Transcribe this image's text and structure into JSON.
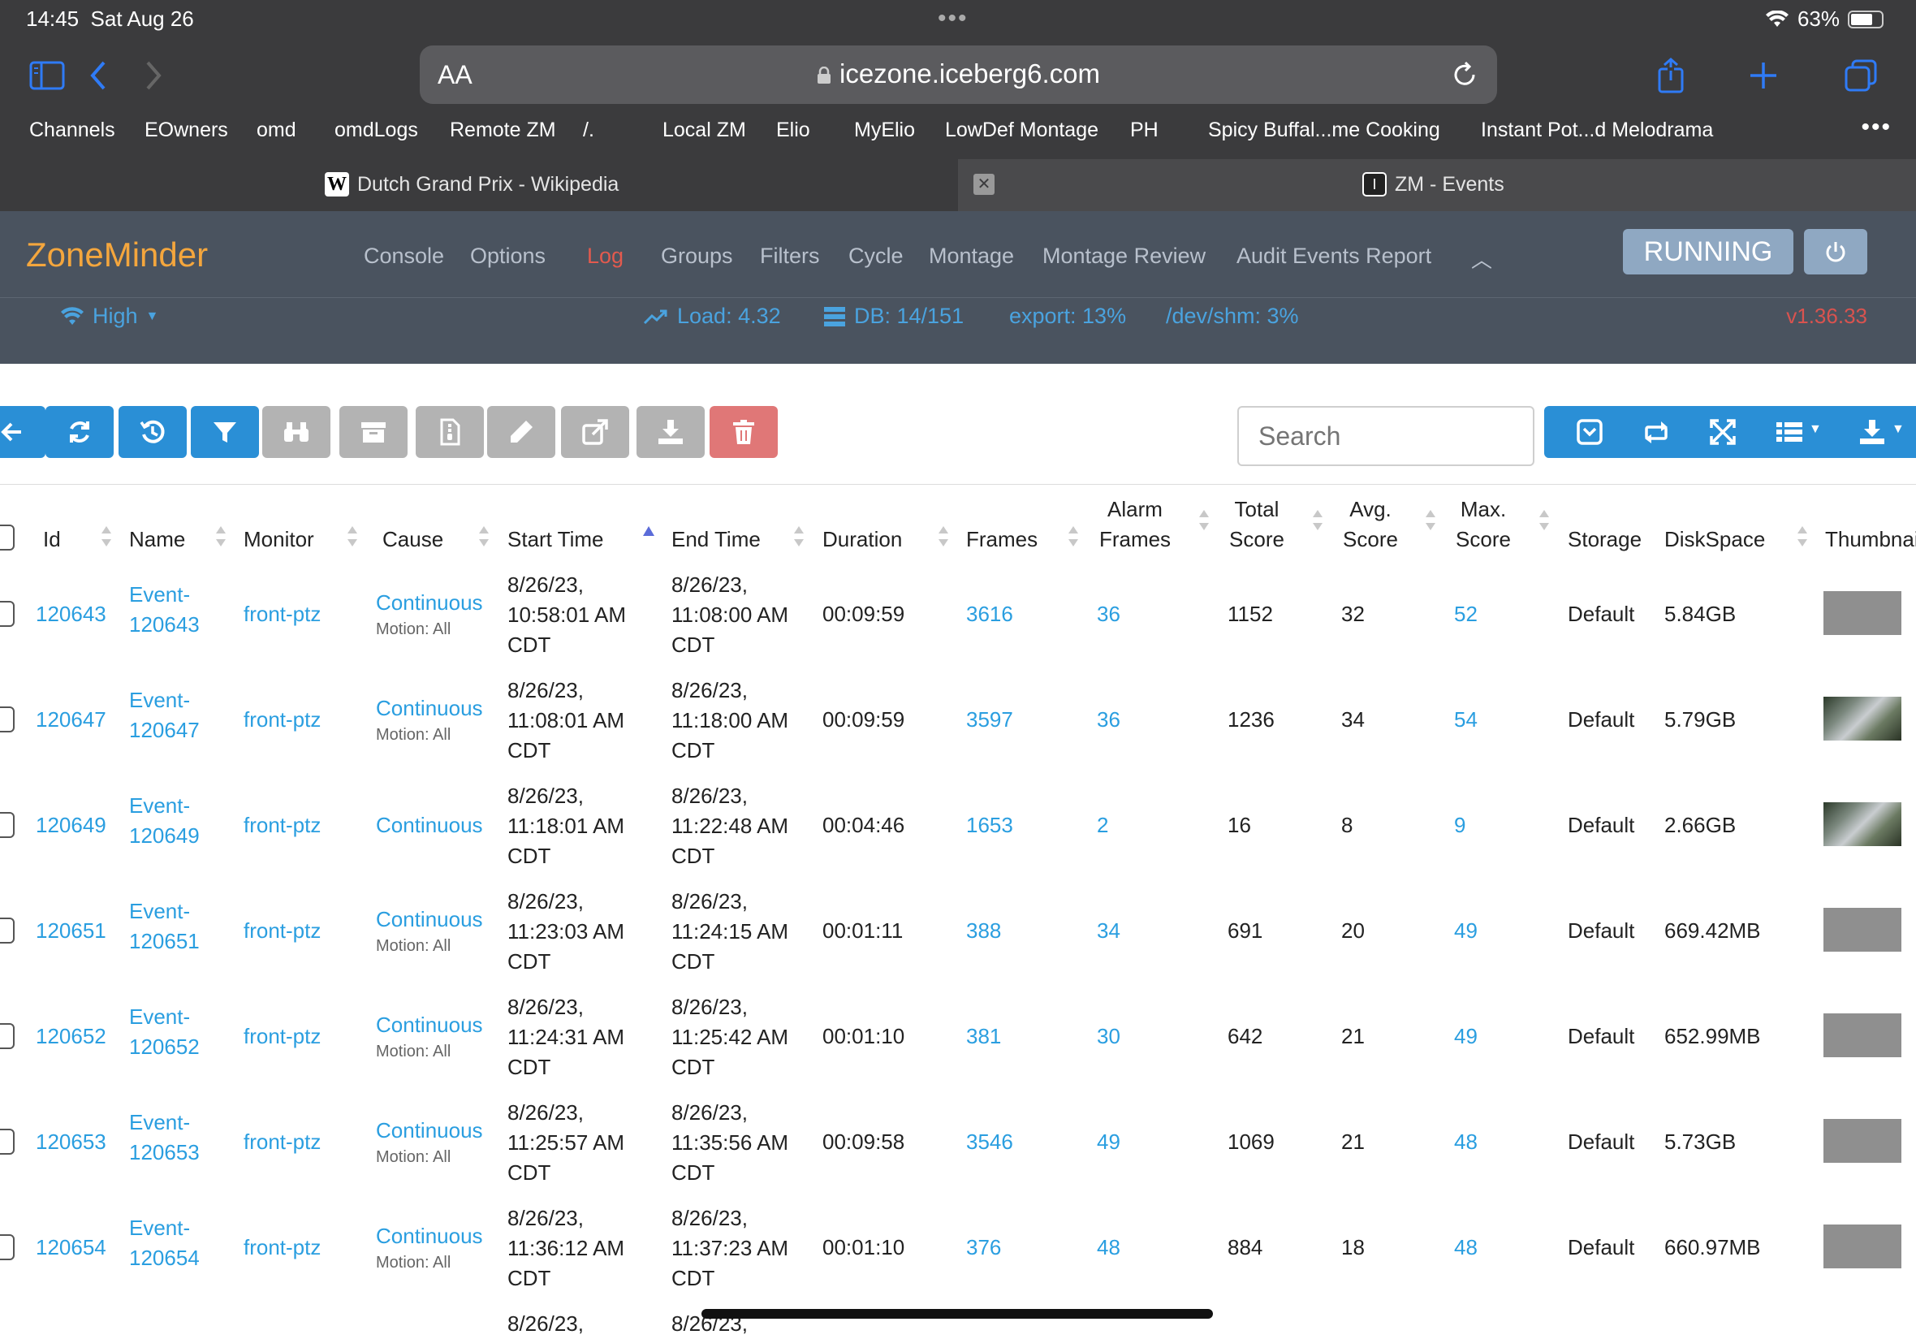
{
  "status": {
    "time": "14:45",
    "date": "Sat Aug 26",
    "battery": "63%"
  },
  "browser": {
    "aa_label": "AA",
    "url": "icezone.iceberg6.com",
    "bookmarks": [
      "Channels",
      "EOwners",
      "omd",
      "omdLogs",
      "Remote ZM",
      "/.",
      "Local ZM",
      "Elio",
      "MyElio",
      "LowDef Montage",
      "PH",
      "Spicy Buffal...me Cooking",
      "Instant Pot...d Melodrama"
    ],
    "tabs": [
      {
        "favicon": "W",
        "title": "Dutch Grand Prix - Wikipedia"
      },
      {
        "favicon": "I",
        "title": "ZM - Events"
      }
    ]
  },
  "zm": {
    "logo": "ZoneMinder",
    "nav": [
      "Console",
      "Options",
      "Log",
      "Groups",
      "Filters",
      "Cycle",
      "Montage",
      "Montage Review",
      "Audit Events Report"
    ],
    "active_nav": "Log",
    "running_label": "RUNNING",
    "bandwidth": "High",
    "load": "Load: 4.32",
    "db": "DB: 14/151",
    "export": "export: 13%",
    "shm": "/dev/shm: 3%",
    "version": "v1.36.33"
  },
  "toolbar": {
    "buttons": [
      "back-icon",
      "refresh-icon",
      "history-icon",
      "filter-icon",
      "binoculars-icon",
      "archive-icon",
      "file-icon",
      "edit-icon",
      "export-icon",
      "download-icon",
      "trash-icon"
    ],
    "search_placeholder": "Search",
    "colors": {
      "blue": "#2a8fd6",
      "disabled": "#b3b3b3",
      "danger": "#e07777"
    }
  },
  "table": {
    "headers": {
      "id": "Id",
      "name": "Name",
      "monitor": "Monitor",
      "cause": "Cause",
      "start": "Start Time",
      "end": "End Time",
      "duration": "Duration",
      "frames": "Frames",
      "alarm1": "Alarm",
      "alarm2": "Frames",
      "total1": "Total",
      "total2": "Score",
      "avg1": "Avg.",
      "avg2": "Score",
      "max1": "Max.",
      "max2": "Score",
      "storage": "Storage",
      "disk": "DiskSpace",
      "thumb": "Thumbnail"
    },
    "rows": [
      {
        "id": "120643",
        "name1": "Event-",
        "name2": "120643",
        "monitor": "front-ptz",
        "cause": "Continuous",
        "cause_sub": "Motion: All",
        "start1": "8/26/23,",
        "start2": "10:58:01 AM",
        "start3": "CDT",
        "end1": "8/26/23,",
        "end2": "11:08:00 AM",
        "end3": "CDT",
        "duration": "00:09:59",
        "frames": "3616",
        "alarm": "36",
        "total": "1152",
        "avg": "32",
        "max": "52",
        "storage": "Default",
        "disk": "5.84GB"
      },
      {
        "id": "120647",
        "name1": "Event-",
        "name2": "120647",
        "monitor": "front-ptz",
        "cause": "Continuous",
        "cause_sub": "Motion: All",
        "start1": "8/26/23,",
        "start2": "11:08:01 AM",
        "start3": "CDT",
        "end1": "8/26/23,",
        "end2": "11:18:00 AM",
        "end3": "CDT",
        "duration": "00:09:59",
        "frames": "3597",
        "alarm": "36",
        "total": "1236",
        "avg": "34",
        "max": "54",
        "storage": "Default",
        "disk": "5.79GB"
      },
      {
        "id": "120649",
        "name1": "Event-",
        "name2": "120649",
        "monitor": "front-ptz",
        "cause": "Continuous",
        "cause_sub": "",
        "start1": "8/26/23,",
        "start2": "11:18:01 AM",
        "start3": "CDT",
        "end1": "8/26/23,",
        "end2": "11:22:48 AM",
        "end3": "CDT",
        "duration": "00:04:46",
        "frames": "1653",
        "alarm": "2",
        "total": "16",
        "avg": "8",
        "max": "9",
        "storage": "Default",
        "disk": "2.66GB"
      },
      {
        "id": "120651",
        "name1": "Event-",
        "name2": "120651",
        "monitor": "front-ptz",
        "cause": "Continuous",
        "cause_sub": "Motion: All",
        "start1": "8/26/23,",
        "start2": "11:23:03 AM",
        "start3": "CDT",
        "end1": "8/26/23,",
        "end2": "11:24:15 AM",
        "end3": "CDT",
        "duration": "00:01:11",
        "frames": "388",
        "alarm": "34",
        "total": "691",
        "avg": "20",
        "max": "49",
        "storage": "Default",
        "disk": "669.42MB"
      },
      {
        "id": "120652",
        "name1": "Event-",
        "name2": "120652",
        "monitor": "front-ptz",
        "cause": "Continuous",
        "cause_sub": "Motion: All",
        "start1": "8/26/23,",
        "start2": "11:24:31 AM",
        "start3": "CDT",
        "end1": "8/26/23,",
        "end2": "11:25:42 AM",
        "end3": "CDT",
        "duration": "00:01:10",
        "frames": "381",
        "alarm": "30",
        "total": "642",
        "avg": "21",
        "max": "49",
        "storage": "Default",
        "disk": "652.99MB"
      },
      {
        "id": "120653",
        "name1": "Event-",
        "name2": "120653",
        "monitor": "front-ptz",
        "cause": "Continuous",
        "cause_sub": "Motion: All",
        "start1": "8/26/23,",
        "start2": "11:25:57 AM",
        "start3": "CDT",
        "end1": "8/26/23,",
        "end2": "11:35:56 AM",
        "end3": "CDT",
        "duration": "00:09:58",
        "frames": "3546",
        "alarm": "49",
        "total": "1069",
        "avg": "21",
        "max": "48",
        "storage": "Default",
        "disk": "5.73GB"
      },
      {
        "id": "120654",
        "name1": "Event-",
        "name2": "120654",
        "monitor": "front-ptz",
        "cause": "Continuous",
        "cause_sub": "Motion: All",
        "start1": "8/26/23,",
        "start2": "11:36:12 AM",
        "start3": "CDT",
        "end1": "8/26/23,",
        "end2": "11:37:23 AM",
        "end3": "CDT",
        "duration": "00:01:10",
        "frames": "376",
        "alarm": "48",
        "total": "884",
        "avg": "18",
        "max": "48",
        "storage": "Default",
        "disk": "660.97MB"
      }
    ],
    "partial_row": {
      "start1": "8/26/23,",
      "end1": "8/26/23,"
    }
  }
}
